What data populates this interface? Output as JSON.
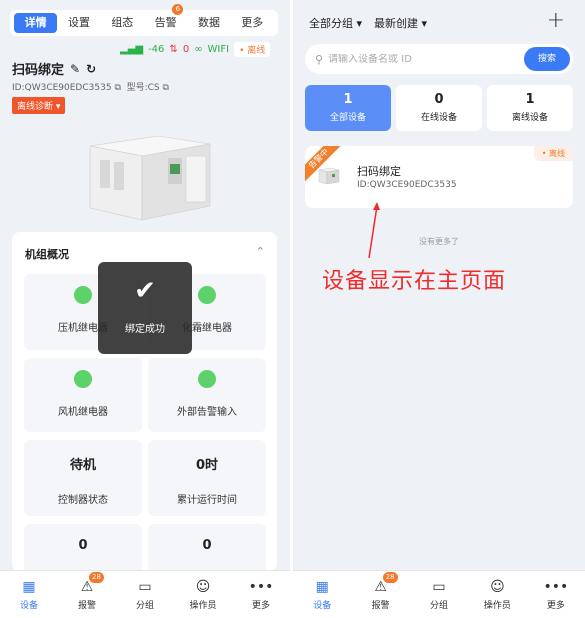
{
  "left": {
    "tabs": [
      {
        "label": "详情",
        "active": true
      },
      {
        "label": "设置"
      },
      {
        "label": "组态"
      },
      {
        "label": "告警",
        "badge": "6"
      },
      {
        "label": "数据"
      },
      {
        "label": "更多"
      }
    ],
    "signal": "-46",
    "conn_count": "0",
    "wifi": "WIFI",
    "offline": "• 离线",
    "device_name": "扫码绑定",
    "device_id": "ID:QW3CE90EDC3535",
    "model": "型号:CS",
    "diag_button": "离线诊断",
    "card_title": "机组概况",
    "cells": [
      {
        "label": "压机继电器"
      },
      {
        "label": "化霜继电器"
      },
      {
        "label": "风机继电器"
      },
      {
        "label": "外部告警输入"
      },
      {
        "value": "待机",
        "label": "控制器状态"
      },
      {
        "value": "0时",
        "label": "累计运行时间"
      },
      {
        "value": "0"
      },
      {
        "value": "0"
      }
    ],
    "toast": "绑定成功"
  },
  "nav": [
    {
      "label": "设备",
      "icon": "grid-icon",
      "active": true
    },
    {
      "label": "报警",
      "icon": "warning-icon",
      "badge": "28"
    },
    {
      "label": "分组",
      "icon": "folder-icon"
    },
    {
      "label": "操作员",
      "icon": "user-icon"
    },
    {
      "label": "更多",
      "icon": "more-icon"
    }
  ],
  "right": {
    "group_filter": "全部分组",
    "sort_filter": "最新创建",
    "search_placeholder": "请输入设备名或 ID",
    "search_button": "搜索",
    "stats": [
      {
        "num": "1",
        "label": "全部设备",
        "active": true
      },
      {
        "num": "0",
        "label": "在线设备"
      },
      {
        "num": "1",
        "label": "离线设备"
      }
    ],
    "device": {
      "ribbon": "告警中",
      "offline": "• 离线",
      "name": "扫码绑定",
      "id": "ID:QW3CE90EDC3535"
    },
    "no_more": "没有更多了",
    "annotation": "设备显示在主页面"
  },
  "colors": {
    "accent": "#3a7af5",
    "offline": "#f07a33",
    "ok": "#5ed26a",
    "annotation": "#f02b2b"
  }
}
